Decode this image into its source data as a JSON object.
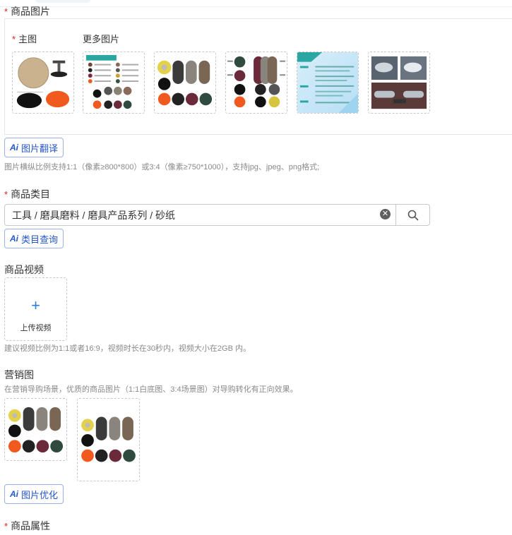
{
  "product_images": {
    "label": "商品图片",
    "main_label": "主图",
    "more_label": "更多图片",
    "thumbnails": [
      {
        "name": "main-image-sanding-pad"
      },
      {
        "name": "more-image-color-chart"
      },
      {
        "name": "more-image-discs-grid"
      },
      {
        "name": "more-image-discs-labeled"
      },
      {
        "name": "more-image-spec-sheet"
      },
      {
        "name": "more-image-car-headlights"
      }
    ],
    "translate_button": "图片翻译",
    "hint": "图片横纵比例支持1:1（像素≥800*800）或3:4（像素≥750*1000），支持jpg、jpeg、png格式;"
  },
  "category": {
    "label": "商品类目",
    "value": "工具 / 磨具磨料 / 磨具产品系列 / 砂纸",
    "query_button": "类目查询"
  },
  "video": {
    "label": "商品视频",
    "upload_label": "上传视频",
    "hint": "建议视频比例为1:1或者16:9，视频时长在30秒内，视频大小在2GB 内。"
  },
  "marketing": {
    "label": "营销图",
    "hint": "在营销导购场景，优质的商品图片（1:1白底图、3:4场景图）对导购转化有正向效果。",
    "optimize_button": "图片优化"
  },
  "attributes": {
    "label": "商品属性"
  },
  "ai_badge": "Ai",
  "colors": {
    "required": "#e02020",
    "accent": "#2456c8"
  }
}
